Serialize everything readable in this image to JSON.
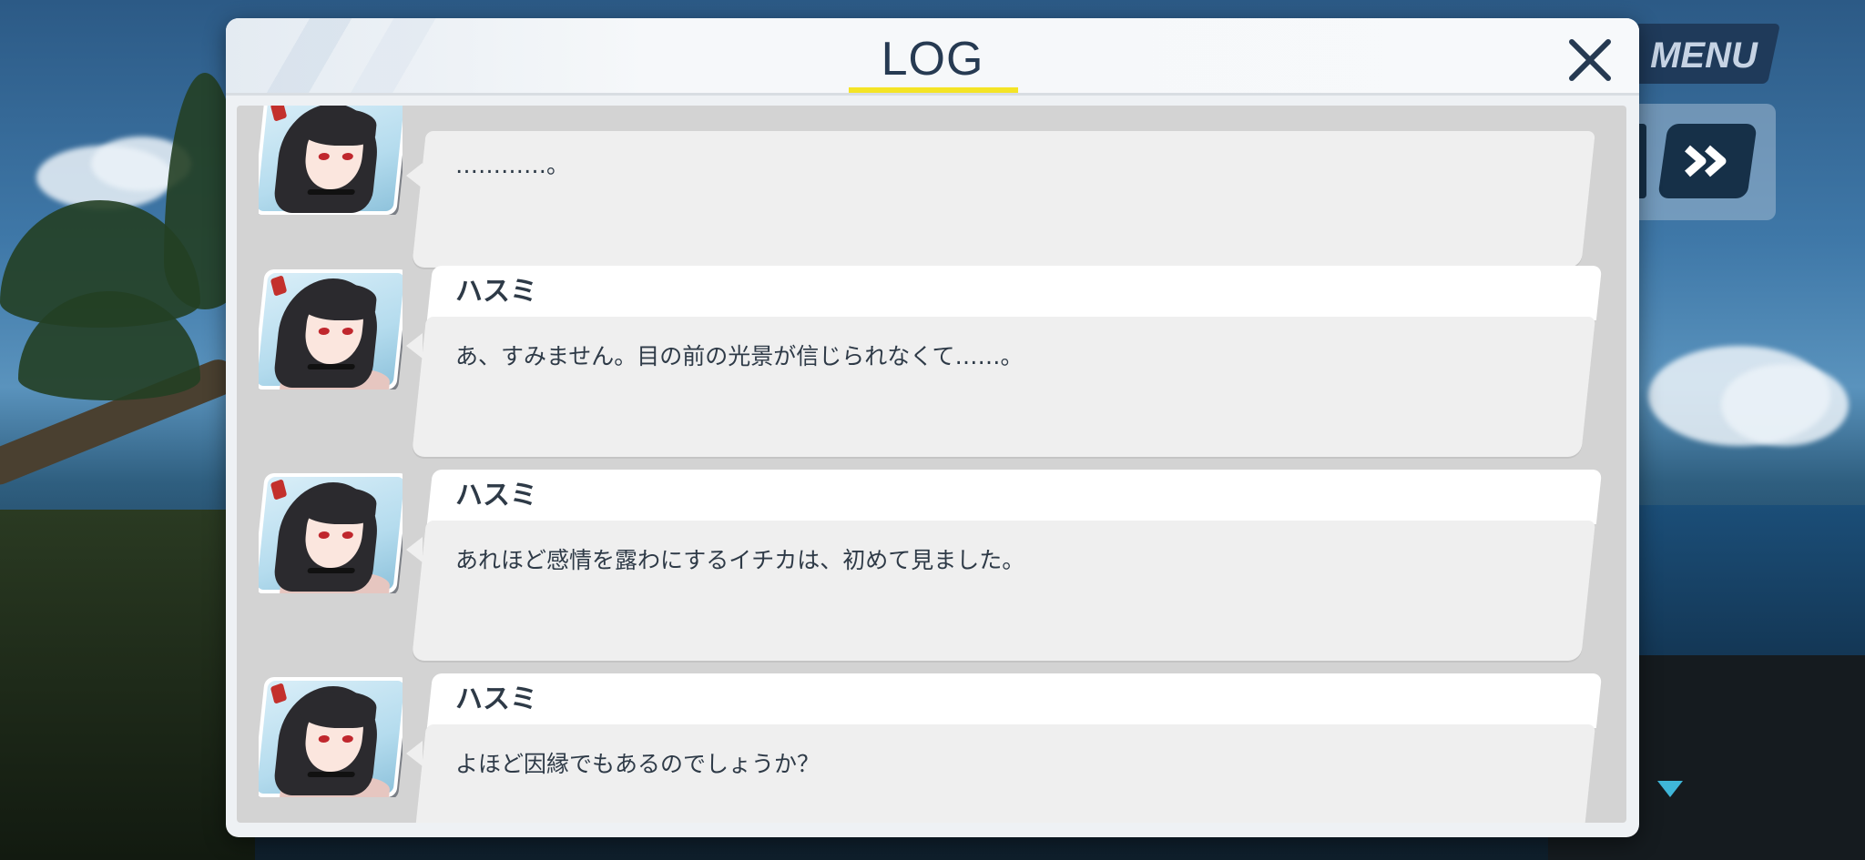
{
  "menu": {
    "label": "MENU"
  },
  "log": {
    "title": "LOG",
    "entries": [
      {
        "speaker": "",
        "text": "…………。"
      },
      {
        "speaker": "ハスミ",
        "text": "あ、すみません。目の前の光景が信じられなくて……。"
      },
      {
        "speaker": "ハスミ",
        "text": "あれほど感情を露わにするイチカは、初めて見ました。"
      },
      {
        "speaker": "ハスミ",
        "text": "よほど因縁でもあるのでしょうか？"
      }
    ]
  },
  "colors": {
    "accent_underline": "#f4e425",
    "title_text": "#263a52",
    "panel_bg": "#eef1f4"
  }
}
